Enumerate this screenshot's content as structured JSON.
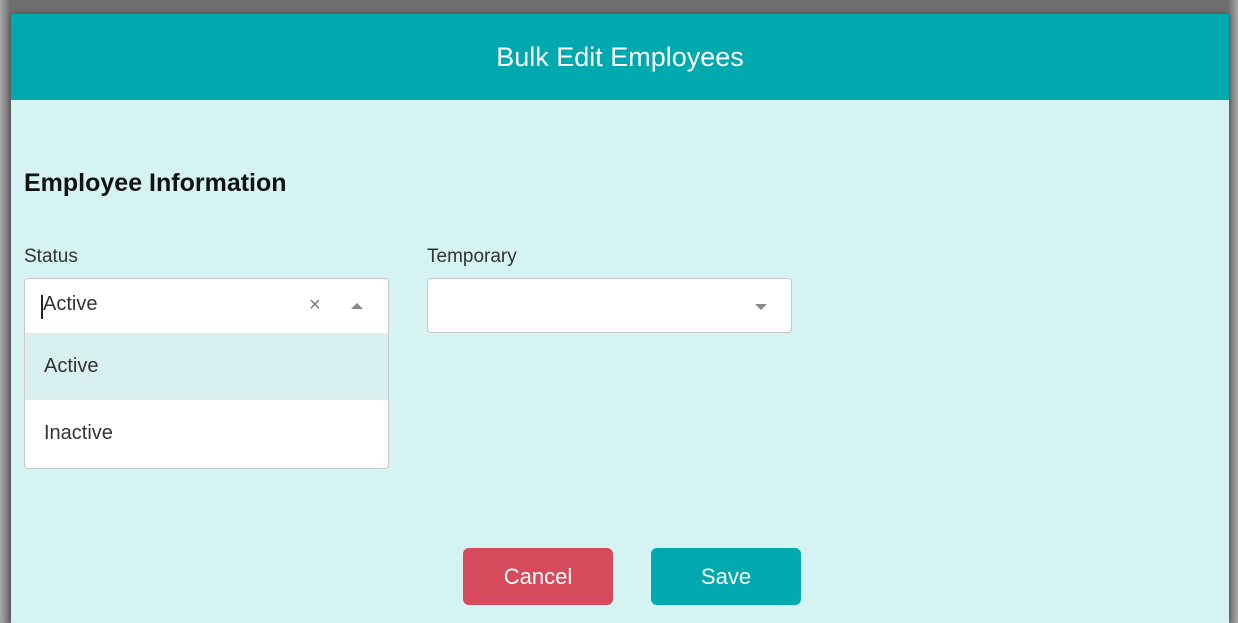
{
  "modal": {
    "title": "Bulk Edit Employees"
  },
  "section": {
    "title": "Employee Information"
  },
  "status": {
    "label": "Status",
    "value": "Active",
    "clear_glyph": "×",
    "options": [
      {
        "label": "Active",
        "highlighted": true
      },
      {
        "label": "Inactive",
        "highlighted": false
      }
    ]
  },
  "temporary": {
    "label": "Temporary",
    "value": ""
  },
  "buttons": {
    "cancel_label": "Cancel",
    "save_label": "Save"
  },
  "colors": {
    "header": "#00a9ad",
    "body": "#d5f3f3",
    "cancel": "#d64a5b",
    "save": "#00a9ad",
    "highlight": "#d9f0f0"
  },
  "icons": {
    "clear": "close-icon",
    "status_toggle": "chevron-up-icon",
    "temporary_toggle": "chevron-down-icon"
  }
}
